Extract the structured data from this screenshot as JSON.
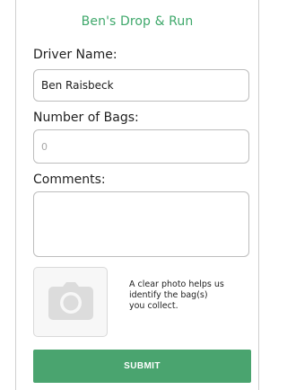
{
  "app": {
    "title": "Ben's Drop & Run"
  },
  "form": {
    "driver_label": "Driver Name:",
    "driver_value": "Ben Raisbeck",
    "bags_label": "Number of Bags:",
    "bags_placeholder": "0",
    "comments_label": "Comments:",
    "comments_value": ""
  },
  "photo": {
    "icon": "camera-icon",
    "hint_line1": "A clear photo helps us",
    "hint_line2": "identify the bag(s)",
    "hint_line3": "you collect."
  },
  "actions": {
    "submit_label": "SUBMIT"
  },
  "colors": {
    "accent": "#4aa46f",
    "title_green": "#3fa86b"
  }
}
